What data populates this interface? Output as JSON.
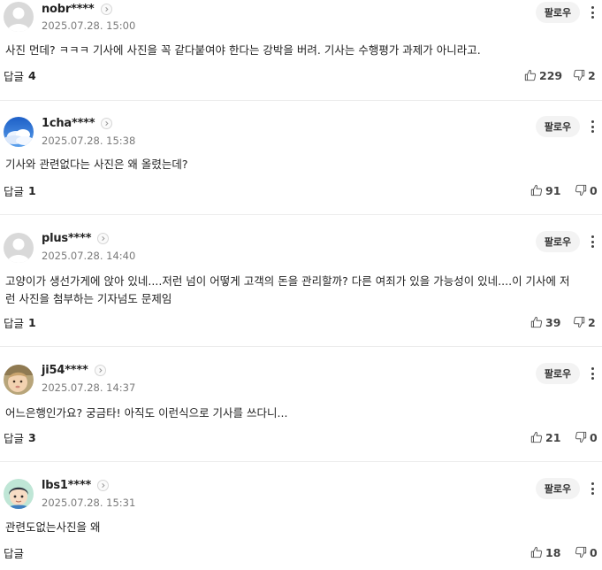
{
  "comments": [
    {
      "username": "nobr****",
      "timestamp": "2025.07.28. 15:00",
      "follow_label": "팔로우",
      "text": "사진 먼데? ㅋㅋㅋ 기사에 사진을 꼭 같다붙여야 한다는 강박을 버려. 기사는 수행평가 과제가 아니라고.",
      "reply_label": "답글",
      "reply_count": "4",
      "likes": "229",
      "dislikes": "2",
      "avatar": "default-avatar"
    },
    {
      "username": "1cha****",
      "timestamp": "2025.07.28. 15:38",
      "follow_label": "팔로우",
      "text": "기사와 관련없다는 사진은 왜 올렸는데?",
      "reply_label": "답글",
      "reply_count": "1",
      "likes": "91",
      "dislikes": "0",
      "avatar": "sky-cloud-avatar"
    },
    {
      "username": "plus****",
      "timestamp": "2025.07.28. 14:40",
      "follow_label": "팔로우",
      "text": "고양이가 생선가게에 앉아 있네....저런 넘이 어떻게 고객의 돈을 관리할까? 다른 여죄가 있을 가능성이 있네....이 기사에 저런 사진을 첨부하는 기자넘도 문제임",
      "reply_label": "답글",
      "reply_count": "1",
      "likes": "39",
      "dislikes": "2",
      "avatar": "default-avatar"
    },
    {
      "username": "ji54****",
      "timestamp": "2025.07.28. 14:37",
      "follow_label": "팔로우",
      "text": "어느은행인가요? 궁금타! 아직도 이런식으로 기사를 쓰다니...",
      "reply_label": "답글",
      "reply_count": "3",
      "likes": "21",
      "dislikes": "0",
      "avatar": "baby-photo-avatar"
    },
    {
      "username": "lbs1****",
      "timestamp": "2025.07.28. 15:31",
      "follow_label": "팔로우",
      "text": "관련도없는사진을 왜",
      "reply_label": "답글",
      "reply_count": "",
      "likes": "18",
      "dislikes": "0",
      "avatar": "cartoon-boy-avatar"
    }
  ]
}
